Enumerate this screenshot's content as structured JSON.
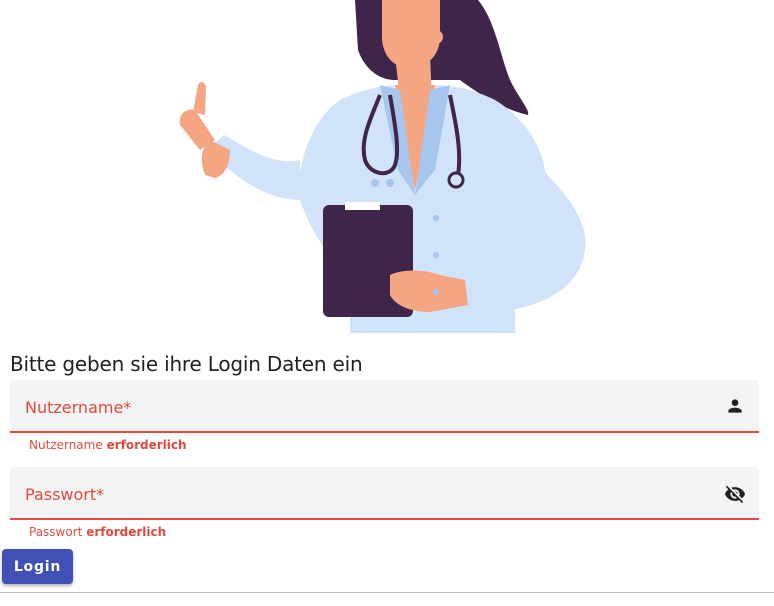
{
  "illustration": {
    "name": "doctor-illustration"
  },
  "form": {
    "heading": "Bitte geben sie ihre Login Daten ein",
    "username": {
      "label": "Nutzername*",
      "error_prefix": "Nutzername",
      "error_suffix": "erforderlich",
      "icon": "person-icon"
    },
    "password": {
      "label": "Passwort*",
      "error_prefix": "Passwort",
      "error_suffix": "erforderlich",
      "icon": "visibility-off-icon"
    },
    "login_label": "Login"
  },
  "colors": {
    "error": "#e0493e",
    "primary": "#3f51b5",
    "field_bg": "#f4f4f4"
  }
}
